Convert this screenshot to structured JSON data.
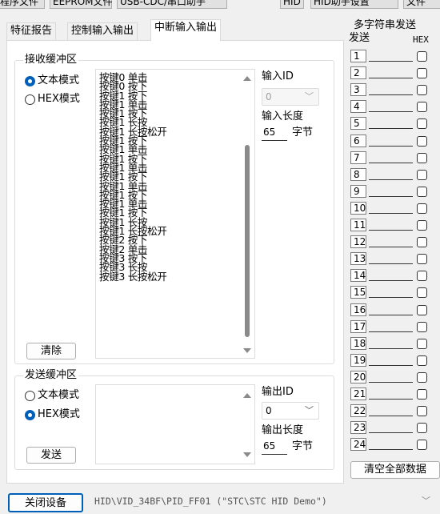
{
  "toolbar": {
    "buttons": [
      "程序文件",
      "EEPROM文件",
      "USB-CDC/串口助手",
      "HID",
      "HID助手设置",
      "文件"
    ]
  },
  "tabs": [
    "特征报告",
    "控制输入输出",
    "中断输入输出"
  ],
  "receive": {
    "title": "接收缓冲区",
    "mode_text": "文本模式",
    "mode_hex": "HEX模式",
    "selected": "text",
    "clear_label": "清除",
    "lines": [
      "按键0 单击",
      "按键0 按下",
      "按键1 按下",
      "按键1 单击",
      "按键1 按下",
      "按键1 长按",
      "按键1 长按松开",
      "按键1 按下",
      "按键1 单击",
      "按键1 按下",
      "按键1 单击",
      "按键1 按下",
      "按键1 单击",
      "按键1 按下",
      "按键1 单击",
      "按键1 按下",
      "按键1 长按",
      "按键1 长按松开",
      "按键2 按下",
      "按键2 单击",
      "按键3 按下",
      "按键3 长按",
      "按键3 长按松开"
    ],
    "input_id_label": "输入ID",
    "input_id_value": "0",
    "input_len_label": "输入长度",
    "input_len_value": "65",
    "byte_unit": "字节"
  },
  "send": {
    "title": "发送缓冲区",
    "mode_text": "文本模式",
    "mode_hex": "HEX模式",
    "selected": "hex",
    "send_label": "发送",
    "output_id_label": "输出ID",
    "output_id_value": "0",
    "output_len_label": "输出长度",
    "output_len_value": "65",
    "byte_unit": "字节"
  },
  "multi": {
    "title": "多字符串发送",
    "col_send": "发送",
    "col_hex": "HEX",
    "rows": [
      "1",
      "2",
      "3",
      "4",
      "5",
      "6",
      "7",
      "8",
      "9",
      "10",
      "11",
      "12",
      "13",
      "14",
      "15",
      "16",
      "17",
      "18",
      "19",
      "20",
      "21",
      "22",
      "23",
      "24"
    ],
    "clear_all_label": "清空全部数据"
  },
  "statusbar": {
    "close_device_label": "关闭设备",
    "device_path": "HID\\VID_34BF\\PID_FF01 (\"STC\\STC HID Demo\")"
  },
  "colors": {
    "accent": "#005fb8",
    "panel_bg": "#f0f0f0"
  }
}
